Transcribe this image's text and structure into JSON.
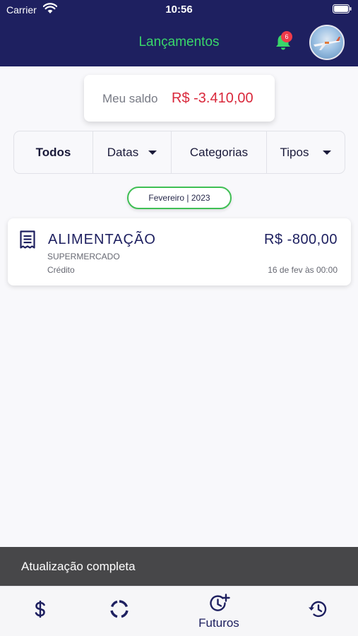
{
  "status_bar": {
    "carrier": "Carrier",
    "time": "10:56"
  },
  "header": {
    "title": "Lançamentos",
    "notification_count": "6",
    "accent": "#39d66a",
    "background": "#1e2060"
  },
  "balance": {
    "label": "Meu saldo",
    "value": "R$ -3.410,00",
    "value_color": "#d9283b"
  },
  "filters": [
    {
      "label": "Todos",
      "has_dropdown": false
    },
    {
      "label": "Datas",
      "has_dropdown": true
    },
    {
      "label": "Categorias",
      "has_dropdown": false
    },
    {
      "label": "Tipos",
      "has_dropdown": true
    }
  ],
  "month_label": "Fevereiro | 2023",
  "entries": [
    {
      "icon": "receipt-icon",
      "category": "ALIMENTAÇÃO",
      "amount": "R$ -800,00",
      "subcategory": "SUPERMERCADO",
      "type": "Crédito",
      "date": "16 de fev às 00:00"
    }
  ],
  "toast": {
    "message": "Atualização completa"
  },
  "tabbar": {
    "items": [
      {
        "icon": "dollar-icon",
        "label": ""
      },
      {
        "icon": "loading-ring-icon",
        "label": ""
      },
      {
        "icon": "future-clock-icon",
        "label": "Futuros"
      },
      {
        "icon": "history-icon",
        "label": ""
      }
    ]
  }
}
